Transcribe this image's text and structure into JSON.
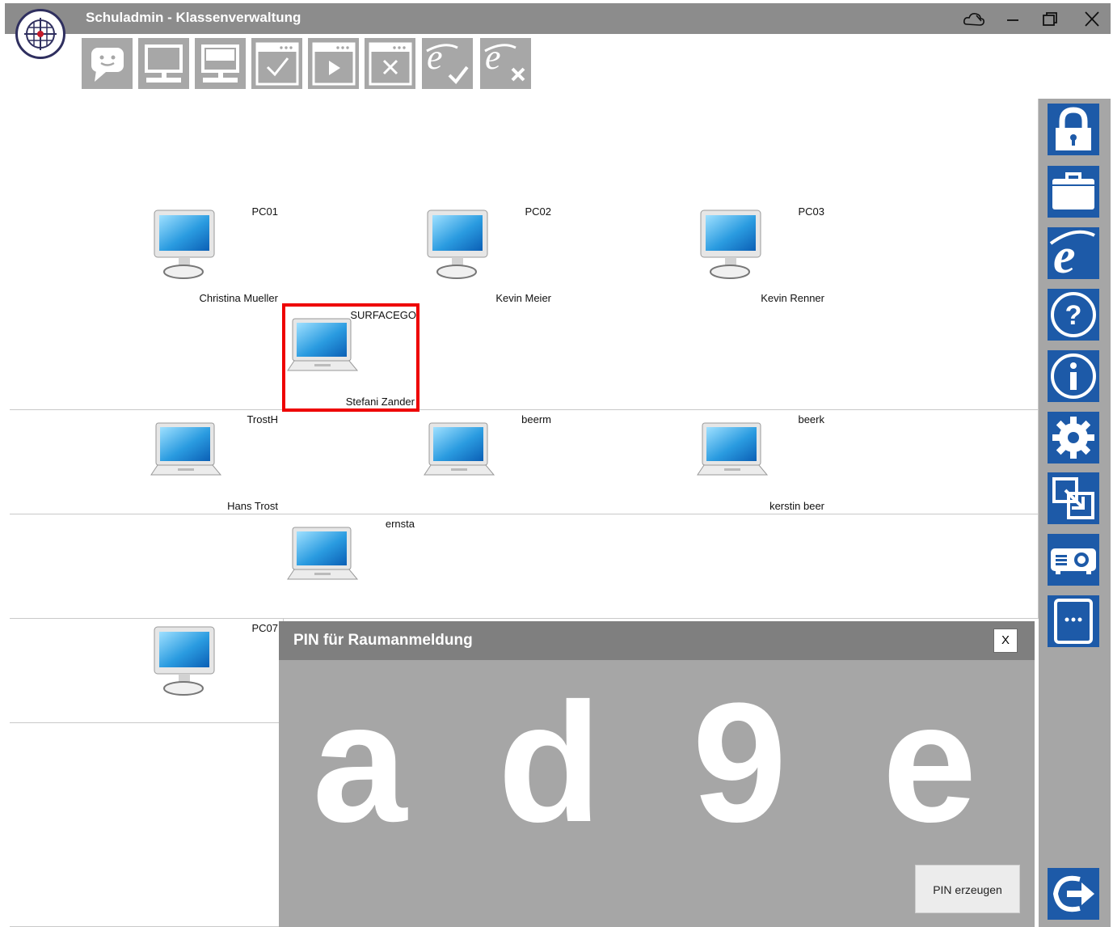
{
  "window": {
    "title": "Schuladmin - Klassenverwaltung",
    "titlebar_color": "#8c8c8c"
  },
  "toolbar": {
    "buttons": [
      "message",
      "screen-view",
      "screen-lock",
      "window-check",
      "window-play",
      "window-close",
      "internet-allow",
      "internet-block"
    ]
  },
  "classroom": {
    "devices": [
      {
        "hostname": "PC01",
        "user": "Christina Mueller",
        "type": "desktop"
      },
      {
        "hostname": "PC02",
        "user": "Kevin Meier",
        "type": "desktop"
      },
      {
        "hostname": "PC03",
        "user": "Kevin Renner",
        "type": "desktop"
      },
      {
        "hostname": "SURFACEGO",
        "user": "Stefani Zander",
        "type": "laptop"
      },
      {
        "hostname": "TrostH",
        "user": "Hans Trost",
        "type": "laptop"
      },
      {
        "hostname": "beerm",
        "user": "",
        "type": "laptop"
      },
      {
        "hostname": "beerk",
        "user": "kerstin beer",
        "type": "laptop"
      },
      {
        "hostname": "ernsta",
        "user": "",
        "type": "laptop"
      },
      {
        "hostname": "PC07",
        "user": "",
        "type": "desktop"
      }
    ]
  },
  "sidebar": {
    "buttons": [
      "lock-icon",
      "briefcase-icon",
      "internet-explorer-icon",
      "help-icon",
      "info-icon",
      "settings-icon",
      "export-icon",
      "projector-icon",
      "tablet-icon",
      "logout-icon"
    ],
    "accent": "#1d5aa8"
  },
  "pin_dialog": {
    "title": "PIN für Raumanmeldung",
    "close_label": "X",
    "pin": [
      "a",
      "d",
      "9",
      "e"
    ],
    "generate_label": "PIN erzeugen"
  }
}
